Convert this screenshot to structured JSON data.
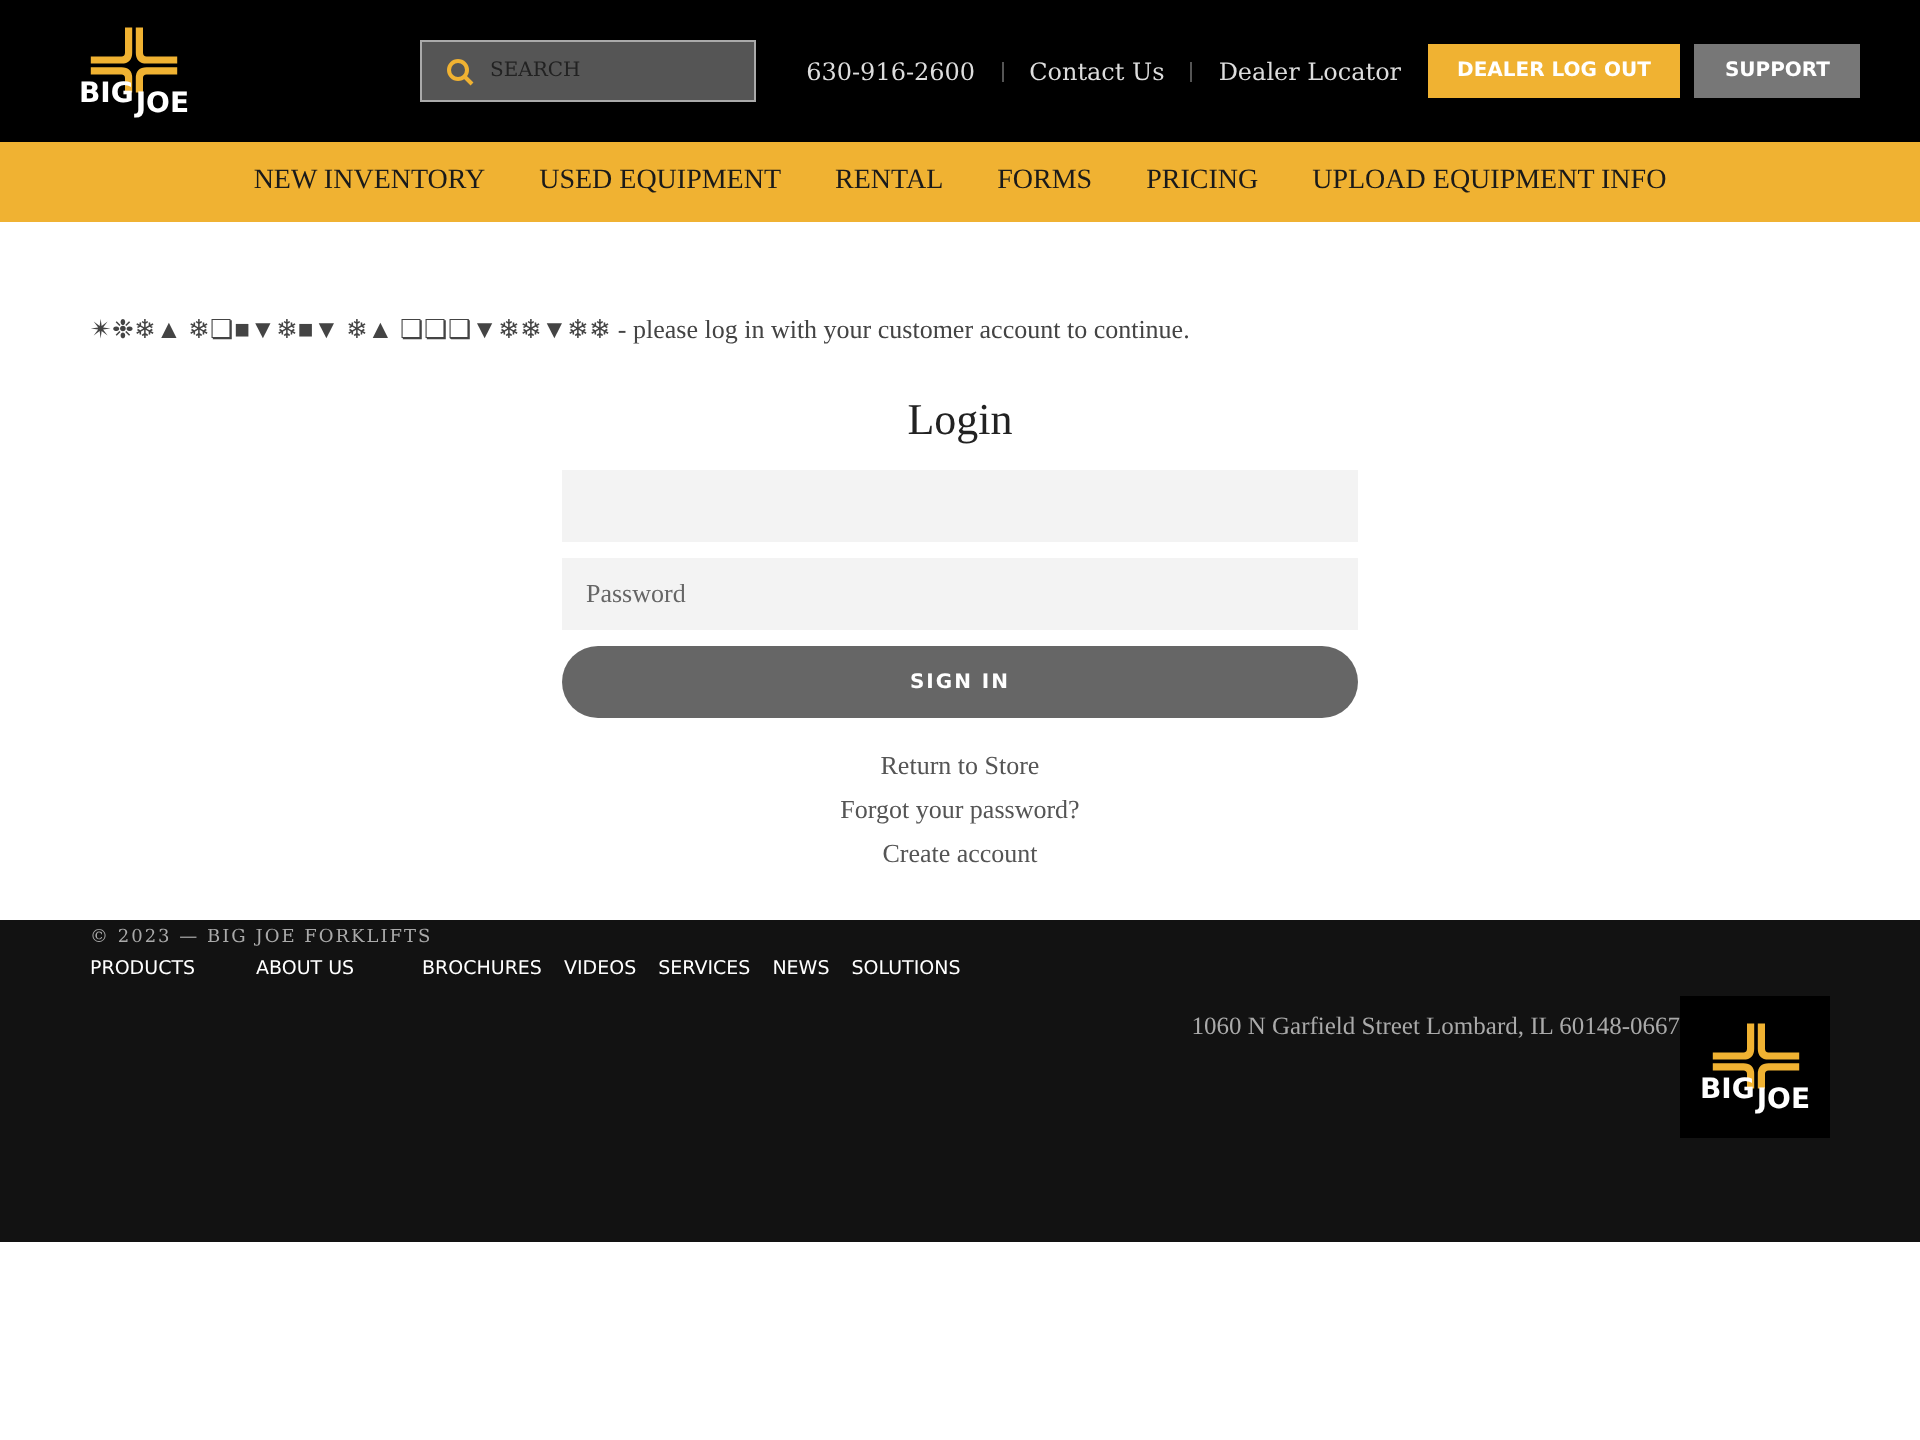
{
  "header": {
    "logo": {
      "word_1": "BIG",
      "word_2": "JOE"
    },
    "search": {
      "placeholder": "SEARCH"
    },
    "phone": "630-916-2600",
    "links": [
      "Contact Us",
      "Dealer Locator"
    ],
    "buttons": [
      {
        "label": "DEALER LOG OUT",
        "kind": "primary"
      },
      {
        "label": "SUPPORT",
        "kind": "secondary"
      }
    ]
  },
  "nav": [
    "NEW INVENTORY",
    "USED EQUIPMENT",
    "RENTAL",
    "FORMS",
    "PRICING",
    "UPLOAD EQUIPMENT INFO"
  ],
  "notice": "✴❉❄▲ ❄❏■▼❄■▼ ❄▲ ❏❏❑▼❄❄▼❄❄ - please log in with your customer account to continue.",
  "login": {
    "title": "Login",
    "password_field": {
      "placeholder": "Password"
    },
    "submit": "SIGN IN",
    "links": [
      "Return to Store",
      "Forgot your password?",
      "Create account"
    ]
  },
  "footer": {
    "copyright": "© 2023 — BIG JOE FORKLIFTS",
    "links": [
      "PRODUCTS",
      "ABOUT US",
      "BROCHURES",
      "VIDEOS",
      "SERVICES",
      "NEWS",
      "SOLUTIONS"
    ],
    "address": "1060 N Garfield Street Lombard, IL 60148-0667",
    "logo": {
      "word_1": "BIG",
      "word_2": "JOE"
    }
  }
}
